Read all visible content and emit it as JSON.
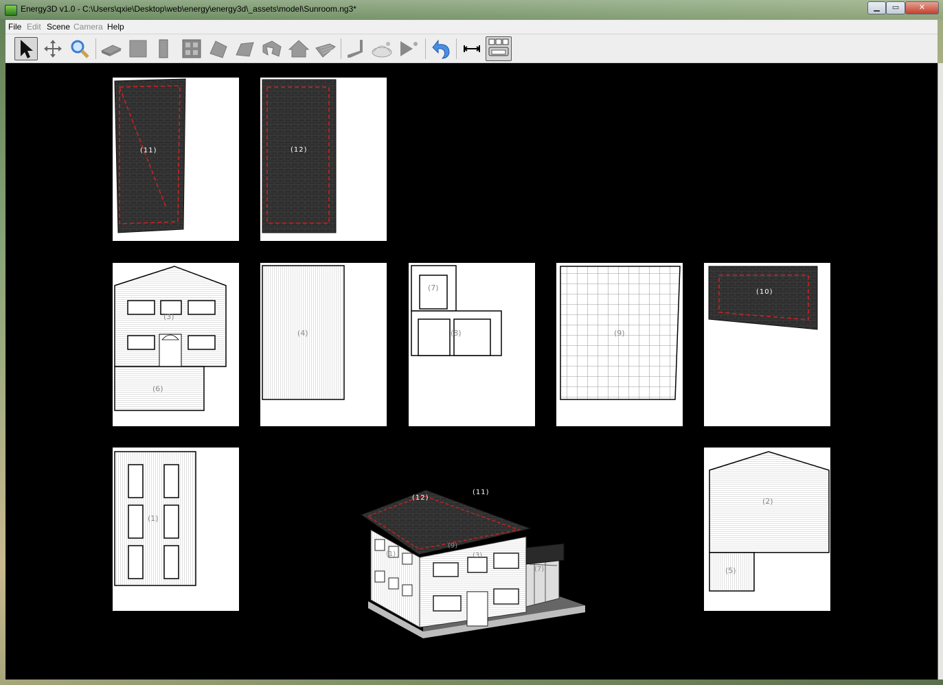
{
  "window": {
    "title": "Energy3D v1.0 - C:\\Users\\qxie\\Desktop\\web\\energy\\energy3d\\_assets\\model\\Sunroom.ng3*",
    "minimize": "▁",
    "maximize": "▭",
    "close": "✕"
  },
  "menu": {
    "file": "File",
    "edit": "Edit",
    "scene": "Scene",
    "camera": "Camera",
    "help": "Help"
  },
  "toolbar": {
    "tools": [
      {
        "name": "select-tool",
        "icon": "arrow-cursor-icon"
      },
      {
        "name": "move-tool",
        "icon": "move-arrows-icon"
      },
      {
        "name": "zoom-tool",
        "icon": "magnifier-icon"
      },
      {
        "name": "foundation-tool",
        "icon": "foundation-icon"
      },
      {
        "name": "wall-tool",
        "icon": "wall-icon"
      },
      {
        "name": "door-tool",
        "icon": "door-icon"
      },
      {
        "name": "window-tool",
        "icon": "window-icon"
      },
      {
        "name": "roof-tool",
        "icon": "roof-icon"
      },
      {
        "name": "hip-roof-tool",
        "icon": "hip-roof-icon"
      },
      {
        "name": "custom-roof-tool",
        "icon": "custom-roof-icon"
      },
      {
        "name": "gable-roof-tool",
        "icon": "gable-roof-icon"
      },
      {
        "name": "floor-tool",
        "icon": "floor-icon"
      },
      {
        "name": "rotate-tool",
        "icon": "rotate-icon"
      },
      {
        "name": "heliodon-tool",
        "icon": "heliodon-icon"
      },
      {
        "name": "sun-animation-tool",
        "icon": "sun-play-icon"
      },
      {
        "name": "undo-tool",
        "icon": "undo-icon"
      },
      {
        "name": "annotation-tool",
        "icon": "dimension-icon"
      },
      {
        "name": "print-preview-tool",
        "icon": "print-preview-icon"
      }
    ]
  },
  "pages": {
    "p11": "(11)",
    "p12": "(12)",
    "p3": "(3)",
    "p6": "(6)",
    "p4": "(4)",
    "p7": "(7)",
    "p8": "(8)",
    "p9": "(9)",
    "p10": "(10)",
    "p1": "(1)",
    "p2": "(2)",
    "p5": "(5)"
  },
  "model": {
    "roof12": "(12)",
    "roof11": "(11)",
    "wall1": "(1)",
    "wall3": "(3)",
    "wall7": "(7)",
    "wall9": "(9)"
  },
  "colors": {
    "roof": "#2a2a2a",
    "dash": "#d42020",
    "viewport": "#000000"
  }
}
